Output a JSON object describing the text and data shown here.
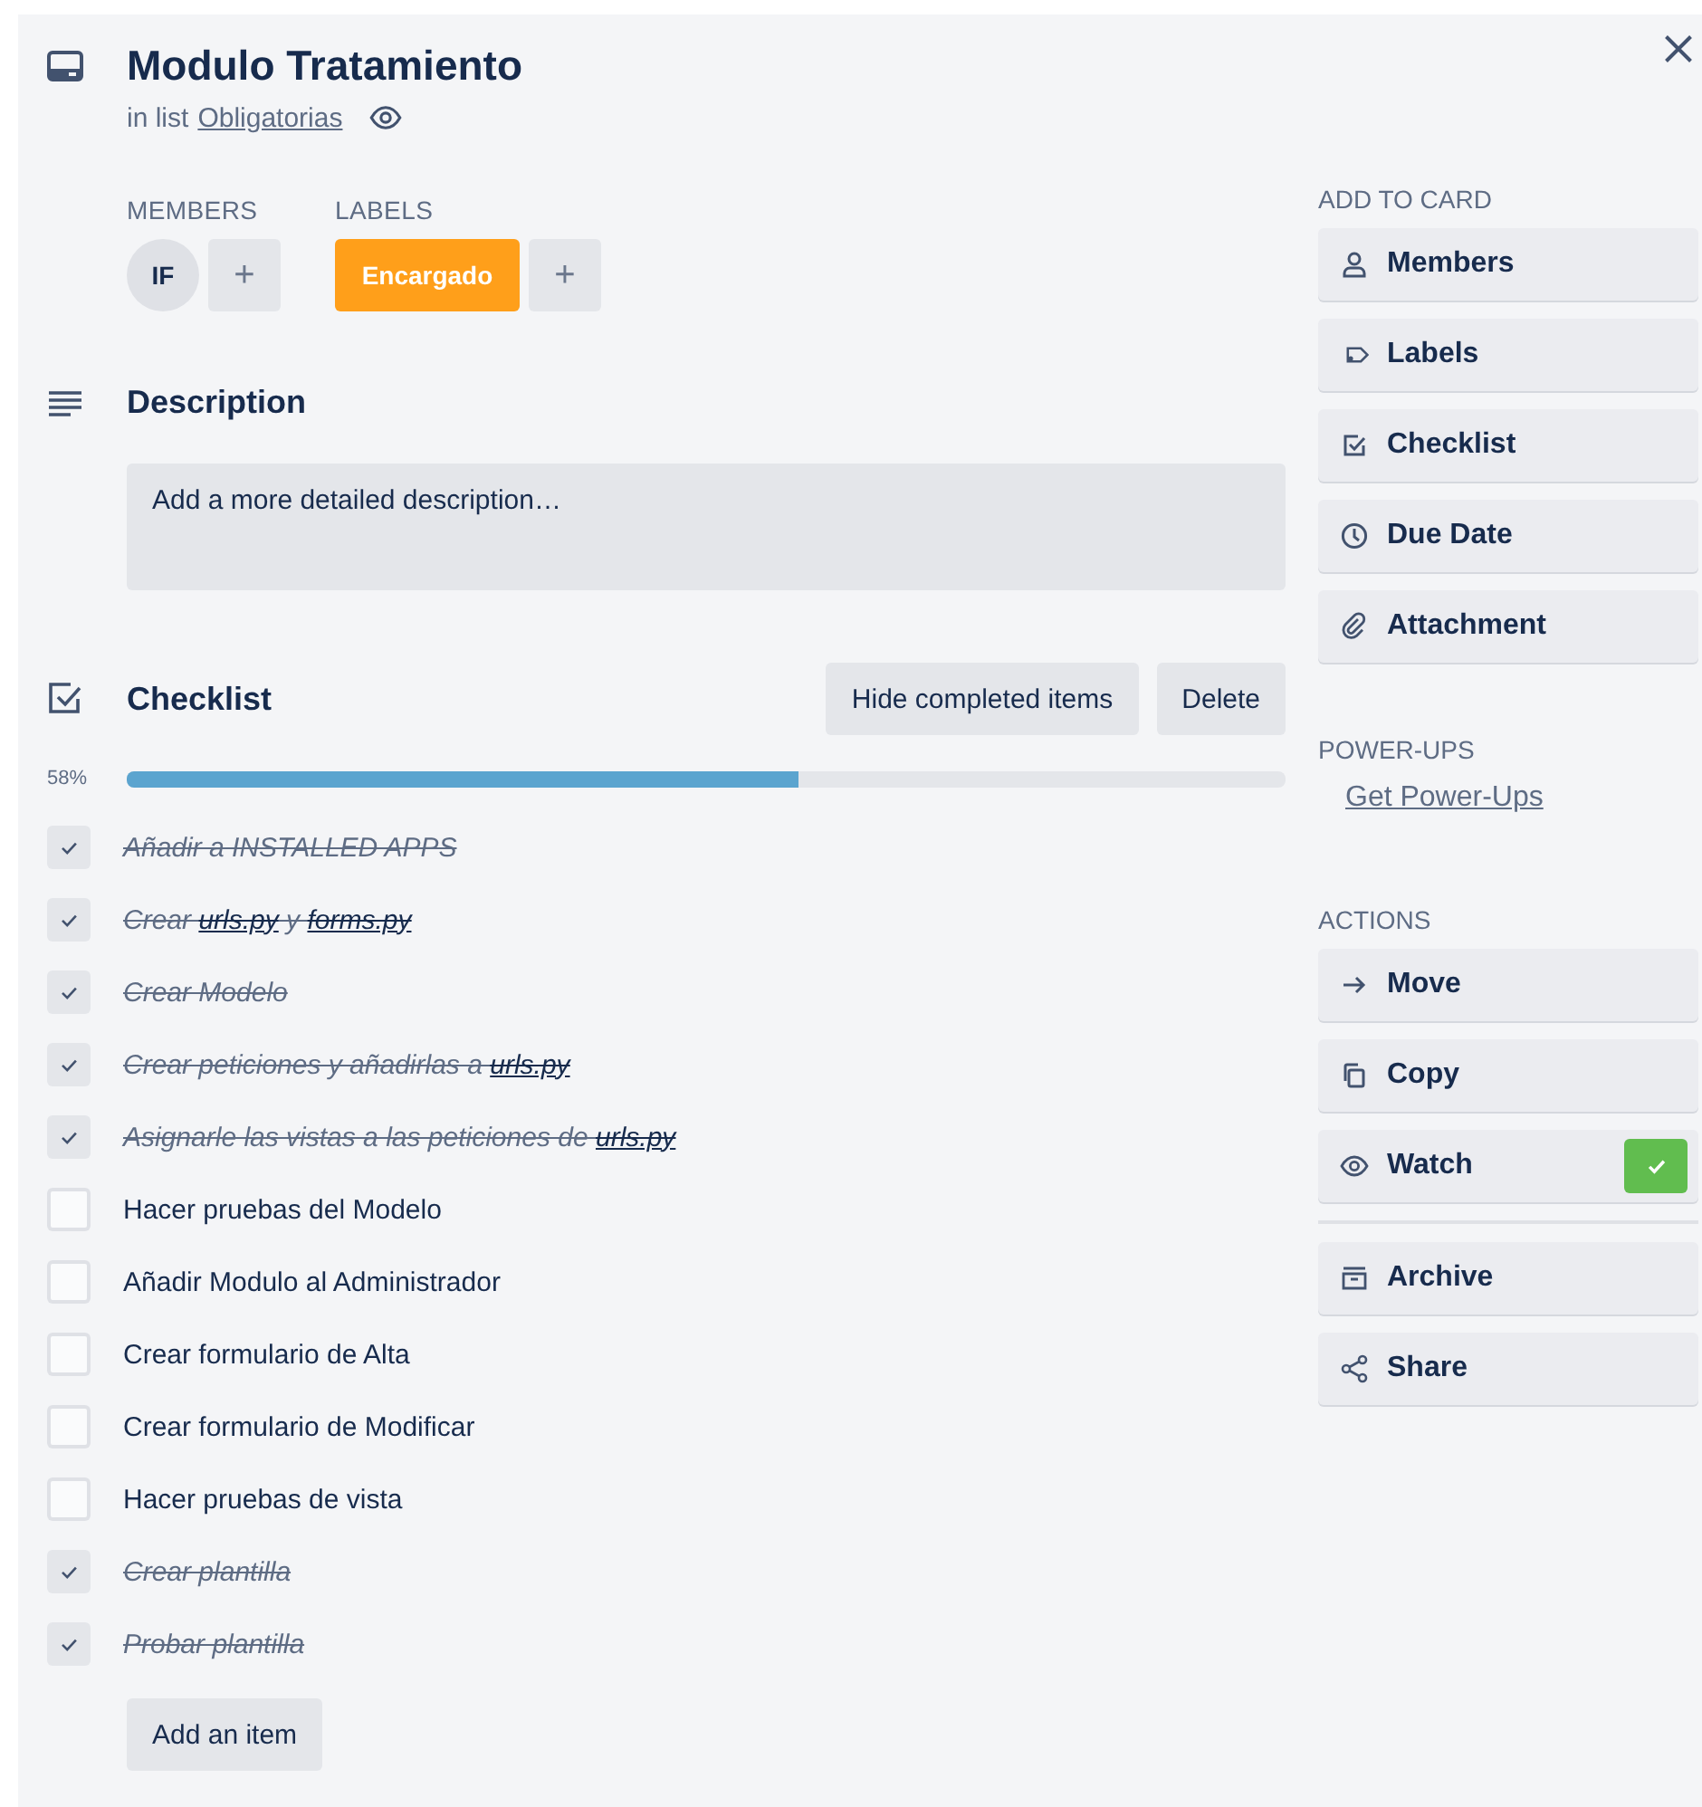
{
  "card": {
    "title": "Modulo Tratamiento",
    "list_prefix": "in list",
    "list_name": "Obligatorias",
    "watching": true
  },
  "members": {
    "heading": "MEMBERS",
    "avatars": [
      "IF"
    ],
    "add": "+"
  },
  "labels": {
    "heading": "LABELS",
    "items": [
      {
        "text": "Encargado",
        "color": "#ff9f1a"
      }
    ],
    "add": "+"
  },
  "description": {
    "heading": "Description",
    "placeholder": "Add a more detailed description…"
  },
  "checklist": {
    "heading": "Checklist",
    "buttons": [
      "Hide completed items",
      "Delete"
    ],
    "progress": {
      "reading": "58%",
      "level": 0.58
    },
    "items": [
      {
        "checked": true,
        "segments": [
          {
            "kind": "text",
            "text": "Añadir a INSTALLED APPS"
          }
        ]
      },
      {
        "checked": true,
        "segments": [
          {
            "kind": "text",
            "text": "Crear "
          },
          {
            "kind": "link",
            "text": "urls.py"
          },
          {
            "kind": "text",
            "text": " y "
          },
          {
            "kind": "link",
            "text": "forms.py"
          }
        ]
      },
      {
        "checked": true,
        "segments": [
          {
            "kind": "text",
            "text": "Crear Modelo"
          }
        ]
      },
      {
        "checked": true,
        "segments": [
          {
            "kind": "text",
            "text": "Crear peticiones y añadirlas a "
          },
          {
            "kind": "link",
            "text": "urls.py"
          }
        ]
      },
      {
        "checked": true,
        "segments": [
          {
            "kind": "text",
            "text": "Asignarle las vistas a las peticiones de "
          },
          {
            "kind": "link",
            "text": "urls.py"
          }
        ]
      },
      {
        "checked": false,
        "segments": [
          {
            "kind": "text",
            "text": "Hacer pruebas del Modelo"
          }
        ]
      },
      {
        "checked": false,
        "segments": [
          {
            "kind": "text",
            "text": "Añadir Modulo al Administrador"
          }
        ]
      },
      {
        "checked": false,
        "segments": [
          {
            "kind": "text",
            "text": "Crear formulario de Alta"
          }
        ]
      },
      {
        "checked": false,
        "segments": [
          {
            "kind": "text",
            "text": "Crear formulario de Modificar"
          }
        ]
      },
      {
        "checked": false,
        "segments": [
          {
            "kind": "text",
            "text": "Hacer pruebas de vista"
          }
        ]
      },
      {
        "checked": true,
        "segments": [
          {
            "kind": "text",
            "text": "Crear plantilla"
          }
        ]
      },
      {
        "checked": true,
        "segments": [
          {
            "kind": "text",
            "text": "Probar plantilla"
          }
        ]
      }
    ],
    "add_item": "Add an item"
  },
  "sidebar": {
    "add_heading": "ADD TO CARD",
    "add_buttons": [
      {
        "label": "Members"
      },
      {
        "label": "Labels"
      },
      {
        "label": "Checklist"
      },
      {
        "label": "Due Date"
      },
      {
        "label": "Attachment"
      }
    ],
    "powerups_heading": "POWER-UPS",
    "powerups_link": "Get Power-Ups",
    "actions_heading": "ACTIONS",
    "actions": [
      {
        "label": "Move"
      },
      {
        "label": "Copy"
      },
      {
        "label": "Watch",
        "checked": true
      },
      {
        "label": "Archive"
      },
      {
        "label": "Share"
      }
    ]
  }
}
